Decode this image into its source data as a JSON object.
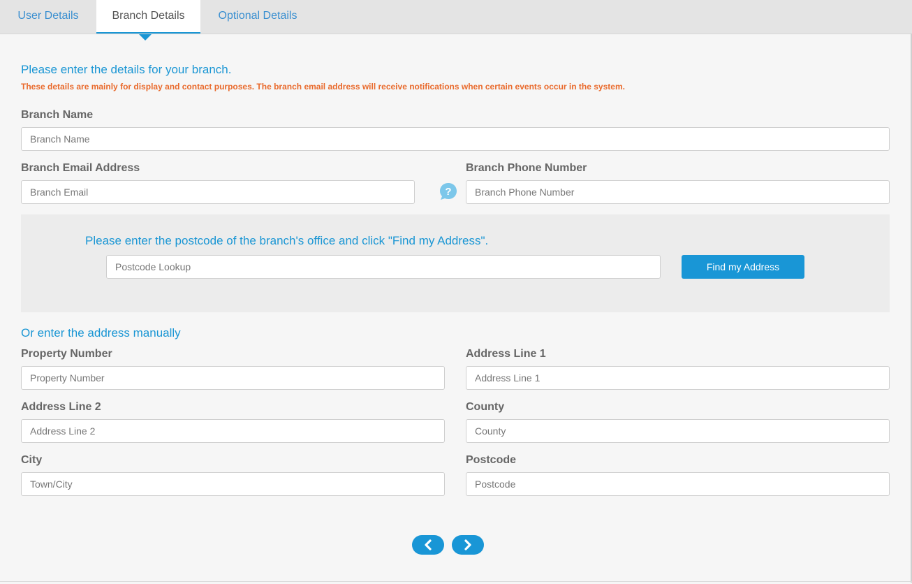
{
  "tabs": [
    {
      "label": "User Details"
    },
    {
      "label": "Branch Details"
    },
    {
      "label": "Optional Details"
    }
  ],
  "intro": {
    "title": "Please enter the details for your branch.",
    "note": "These details are mainly for display and contact purposes. The branch email address will receive notifications when certain events occur in the system."
  },
  "branch_name": {
    "label": "Branch Name",
    "placeholder": "Branch Name",
    "value": ""
  },
  "branch_email": {
    "label": "Branch Email Address",
    "placeholder": "Branch Email",
    "value": ""
  },
  "branch_phone": {
    "label": "Branch Phone Number",
    "placeholder": "Branch Phone Number",
    "value": ""
  },
  "help_icon": {
    "icon": "question-bubble-icon"
  },
  "postcode_lookup": {
    "title": "Please enter the postcode of the branch's office and click \"Find my Address\".",
    "placeholder": "Postcode Lookup",
    "value": "",
    "button_label": "Find my Address"
  },
  "manual": {
    "title": "Or enter the address manually",
    "property_number": {
      "label": "Property Number",
      "placeholder": "Property Number"
    },
    "address_line_1": {
      "label": "Address Line 1",
      "placeholder": "Address Line 1"
    },
    "address_line_2": {
      "label": "Address Line 2",
      "placeholder": "Address Line 2"
    },
    "county": {
      "label": "County",
      "placeholder": "County"
    },
    "city": {
      "label": "City",
      "placeholder": "Town/City"
    },
    "postcode": {
      "label": "Postcode",
      "placeholder": "Postcode"
    }
  },
  "navigation": {
    "prev_icon": "chevron-left-icon",
    "next_icon": "chevron-right-icon"
  },
  "colors": {
    "accent": "#1996d6",
    "warning_text": "#e96a2c",
    "tab_link": "#3a8fd0"
  }
}
